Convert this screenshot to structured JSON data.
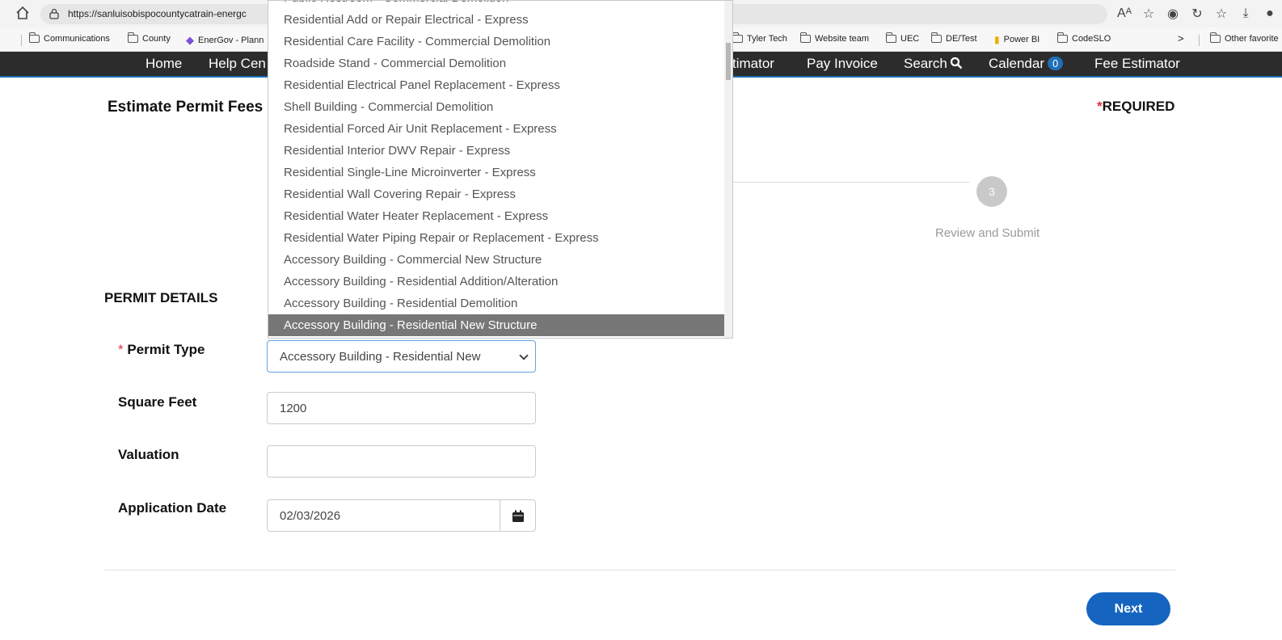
{
  "browser": {
    "url": "https://sanluisobispocountycatrain-energc",
    "bookmarks": [
      {
        "label": "Communications"
      },
      {
        "label": "County"
      },
      {
        "label": "EnerGov - Plann"
      },
      {
        "label": "Tyler Tech"
      },
      {
        "label": "Website team"
      },
      {
        "label": "UEC"
      },
      {
        "label": "DE/Test"
      },
      {
        "label": "Power BI"
      },
      {
        "label": "CodeSLO"
      }
    ],
    "more_bookmarks": ">",
    "other_favorites": "Other favorite"
  },
  "nav": {
    "home": "Home",
    "help": "Help Cen",
    "estimator_partial": "timator",
    "pay_invoice": "Pay Invoice",
    "search": "Search",
    "calendar": "Calendar",
    "calendar_count": "0",
    "fee_estimator": "Fee Estimator"
  },
  "page": {
    "title": "Estimate Permit Fees",
    "required_star": "*",
    "required_label": "REQUIRED"
  },
  "wizard": {
    "step_number": "3",
    "step_label": "Review and Submit"
  },
  "permit_details": {
    "section_title": "PERMIT DETAILS",
    "permit_type_star": "*",
    "permit_type_label": "Permit Type",
    "permit_type_value": "Accessory Building - Residential New",
    "square_feet_label": "Square Feet",
    "square_feet_value": "1200",
    "valuation_label": "Valuation",
    "valuation_value": "",
    "application_date_label": "Application Date",
    "application_date_value": "02/03/2026"
  },
  "dropdown": {
    "options": [
      {
        "label": "Public Restroom - Commercial Demolition"
      },
      {
        "label": "Residential Add or Repair Electrical - Express"
      },
      {
        "label": "Residential Care Facility - Commercial Demolition"
      },
      {
        "label": "Roadside Stand - Commercial Demolition"
      },
      {
        "label": "Residential Electrical Panel Replacement - Express"
      },
      {
        "label": "Shell Building - Commercial Demolition"
      },
      {
        "label": "Residential Forced Air Unit Replacement - Express"
      },
      {
        "label": "Residential Interior DWV Repair - Express"
      },
      {
        "label": "Residential Single-Line Microinverter - Express"
      },
      {
        "label": "Residential Wall Covering Repair - Express"
      },
      {
        "label": "Residential Water Heater Replacement - Express"
      },
      {
        "label": "Residential Water Piping Repair or Replacement - Express"
      },
      {
        "label": "Accessory Building - Commercial New Structure"
      },
      {
        "label": "Accessory Building - Residential Addition/Alteration"
      },
      {
        "label": "Accessory Building - Residential Demolition"
      },
      {
        "label": "Accessory Building - Residential New Structure"
      }
    ],
    "selected_index": 15
  },
  "actions": {
    "next_label": "Next"
  },
  "colors": {
    "nav_bg": "#2c2c2c",
    "accent": "#1565c0",
    "required_star": "#d9333f"
  }
}
